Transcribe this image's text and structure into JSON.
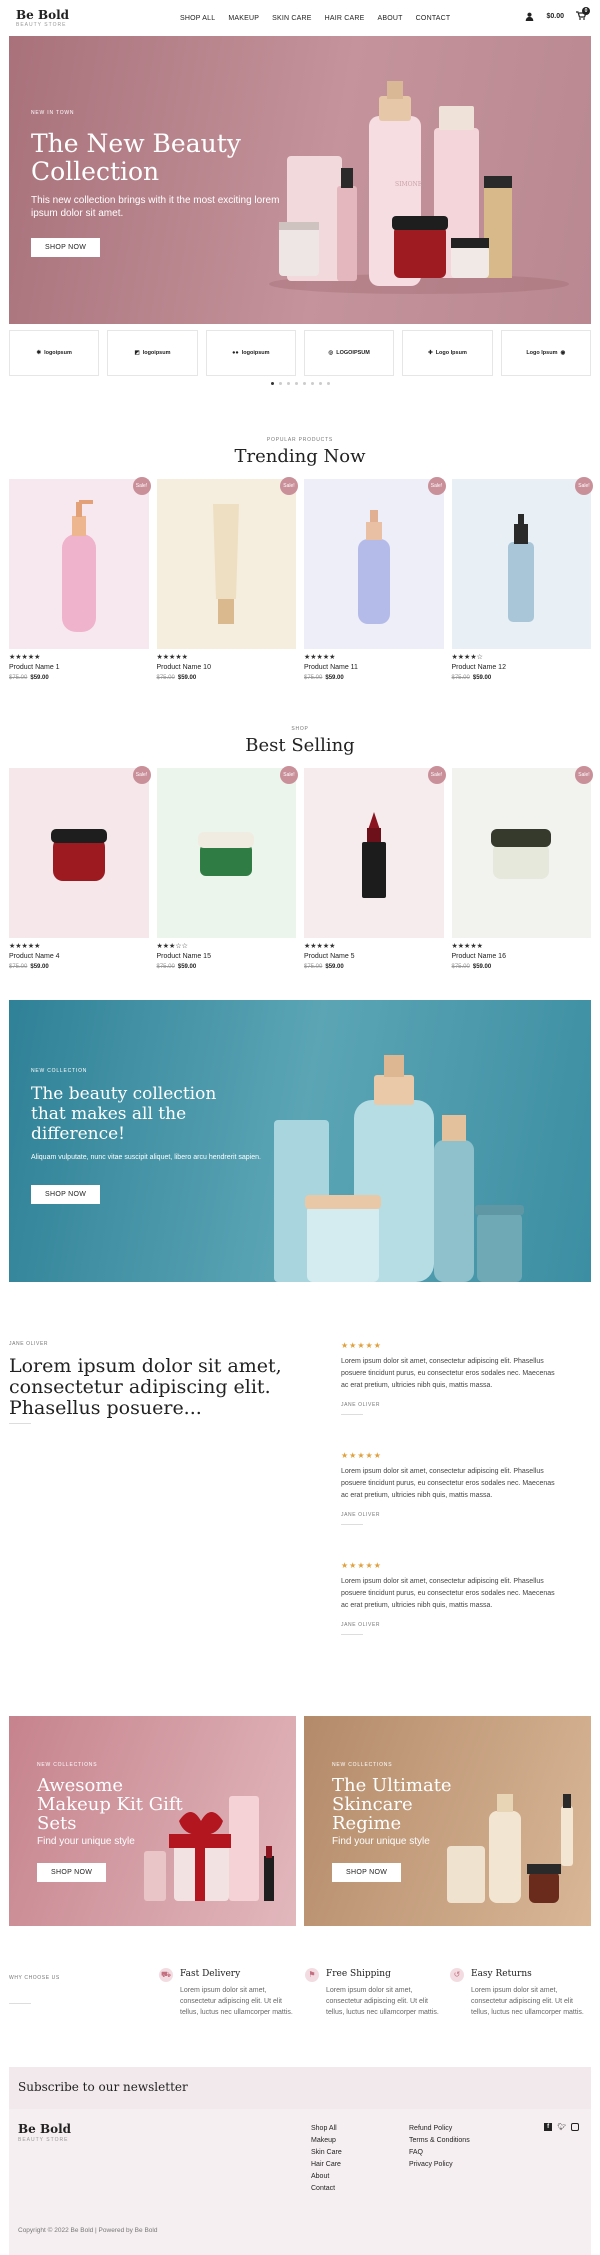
{
  "header": {
    "logo": "Be Bold",
    "tagline": "BEAUTY STORE",
    "nav": [
      "SHOP ALL",
      "MAKEUP",
      "SKIN CARE",
      "HAIR CARE",
      "ABOUT",
      "CONTACT"
    ],
    "cart_total": "$0.00",
    "cart_count": "0"
  },
  "hero": {
    "kicker": "NEW IN TOWN",
    "title": "The New Beauty Collection",
    "text": "This new collection brings with it the most exciting lorem ipsum dolor sit amet.",
    "button": "SHOP NOW",
    "brand_label": "SIMONE"
  },
  "logos": [
    "logoipsum",
    "logoipsum",
    "logoipsum",
    "LOGOIPSUM",
    "Logo Ipsum",
    "Logo Ipsum"
  ],
  "trending": {
    "kicker": "POPULAR PRODUCTS",
    "title": "Trending Now",
    "products": [
      {
        "name": "Product Name 1",
        "old": "$75.00",
        "price": "$59.00",
        "rating": 5,
        "badge": "Sale!",
        "bg": "#f6e8ee"
      },
      {
        "name": "Product Name 10",
        "old": "$75.00",
        "price": "$59.00",
        "rating": 5,
        "badge": "Sale!",
        "bg": "#f5edde"
      },
      {
        "name": "Product Name 11",
        "old": "$75.00",
        "price": "$59.00",
        "rating": 5,
        "badge": "Sale!",
        "bg": "#edeef8"
      },
      {
        "name": "Product Name 12",
        "old": "$75.00",
        "price": "$59.00",
        "rating": 4,
        "badge": "Sale!",
        "bg": "#e9f0f5"
      }
    ]
  },
  "best": {
    "kicker": "SHOP",
    "title": "Best Selling",
    "products": [
      {
        "name": "Product Name 4",
        "old": "$75.00",
        "price": "$59.00",
        "rating": 5,
        "badge": "Sale!",
        "bg": "#f6e8ea"
      },
      {
        "name": "Product Name 15",
        "old": "$75.00",
        "price": "$59.00",
        "rating": 3,
        "badge": "Sale!",
        "bg": "#ecf5ec"
      },
      {
        "name": "Product Name 5",
        "old": "$75.00",
        "price": "$59.00",
        "rating": 5,
        "badge": "Sale!",
        "bg": "#f6ebed"
      },
      {
        "name": "Product Name 16",
        "old": "$75.00",
        "price": "$59.00",
        "rating": 5,
        "badge": "Sale!",
        "bg": "#f2f2ee"
      }
    ]
  },
  "banner": {
    "kicker": "NEW COLLECTION",
    "title": "The beauty collection that makes all the difference!",
    "text": "Aliquam vulputate, nunc vitae suscipit aliquet, libero arcu hendrerit sapien.",
    "button": "SHOP NOW"
  },
  "testimonials": {
    "kicker": "JANE OLIVER",
    "heading": "Lorem ipsum dolor sit amet, consectetur adipiscing elit. Phasellus posuere...",
    "reviews": [
      {
        "text": "Lorem ipsum dolor sit amet, consectetur adipiscing elit. Phasellus posuere tincidunt purus, eu consectetur eros sodales nec. Maecenas ac erat pretium, ultricies nibh quis, mattis massa.",
        "author": "JANE OLIVER",
        "rating": 5
      },
      {
        "text": "Lorem ipsum dolor sit amet, consectetur adipiscing elit. Phasellus posuere tincidunt purus, eu consectetur eros sodales nec. Maecenas ac erat pretium, ultricies nibh quis, mattis massa.",
        "author": "JANE OLIVER",
        "rating": 5
      },
      {
        "text": "Lorem ipsum dolor sit amet, consectetur adipiscing elit. Phasellus posuere tincidunt purus, eu consectetur eros sodales nec. Maecenas ac erat pretium, ultricies nibh quis, mattis massa.",
        "author": "JANE OLIVER",
        "rating": 5
      }
    ]
  },
  "collections": [
    {
      "kicker": "NEW COLLECTIONS",
      "title": "Awesome Makeup Kit Gift Sets",
      "text": "Find your unique style",
      "button": "SHOP NOW"
    },
    {
      "kicker": "NEW COLLECTIONS",
      "title": "The Ultimate Skincare Regime",
      "text": "Find your unique style",
      "button": "SHOP NOW"
    }
  ],
  "features": {
    "kicker": "WHY CHOOSE US",
    "items": [
      {
        "title": "Fast Delivery",
        "text": "Lorem ipsum dolor sit amet, consectetur adipiscing elit. Ut elit tellus, luctus nec ullamcorper mattis."
      },
      {
        "title": "Free Shipping",
        "text": "Lorem ipsum dolor sit amet, consectetur adipiscing elit. Ut elit tellus, luctus nec ullamcorper mattis."
      },
      {
        "title": "Easy Returns",
        "text": "Lorem ipsum dolor sit amet, consectetur adipiscing elit. Ut elit tellus, luctus nec ullamcorper mattis."
      }
    ]
  },
  "newsletter": {
    "title": "Subscribe to our newsletter"
  },
  "footer": {
    "logo": "Be Bold",
    "tagline": "BEAUTY STORE",
    "links1": [
      "Shop All",
      "Makeup",
      "Skin Care",
      "Hair Care",
      "About",
      "Contact"
    ],
    "links2": [
      "Refund Policy",
      "Terms & Conditions",
      "FAQ",
      "Privacy Policy"
    ],
    "social": [
      "f",
      "t",
      "ig"
    ],
    "copyright": "Copyright © 2022 Be Bold | Powered by Be Bold"
  },
  "colors": {
    "accent": "#c9909a",
    "hero": "#b98891",
    "banner": "#3c8ea2",
    "footer": "#f6eff1"
  }
}
